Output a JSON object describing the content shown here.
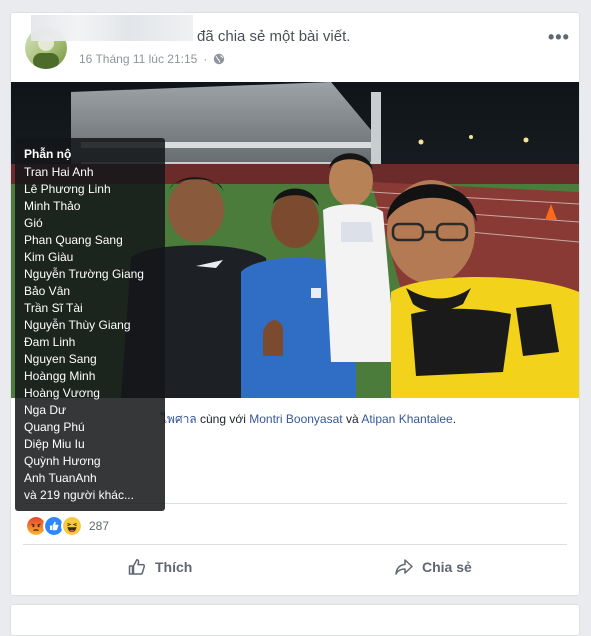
{
  "post": {
    "shared_text": "đã chia sẻ một bài viết.",
    "timestamp": "16 Tháng 11 lúc 21:15",
    "privacy_icon": "globe-icon",
    "more_icon": "more-options-icon",
    "tag_prefix": "ไพศาล",
    "tag_with": "cùng với",
    "tag_person1": "Montri Boonyasat",
    "tag_and": "và",
    "tag_person2": "Atipan Khantalee",
    "tag_end": "."
  },
  "reactions": {
    "icons": [
      "angry-reaction-icon",
      "like-reaction-icon",
      "haha-reaction-icon"
    ],
    "count": "287"
  },
  "actions": {
    "like_label": "Thích",
    "share_label": "Chia sẻ"
  },
  "tooltip": {
    "title": "Phẫn nộ",
    "names": [
      "Tran Hai Anh",
      "Lê Phương Linh",
      "Minh Thảo",
      "Gió",
      "Phan Quang Sang",
      "Kim Giàu",
      "Nguyễn Trường Giang",
      "Bảo Vân",
      "Trần Sĩ Tài",
      "Nguyễn Thùy Giang",
      "Đam Linh",
      "Nguyen Sang",
      "Hoàngg Minh",
      "Hoàng Vương",
      "Nga Dư",
      "Quang Phú",
      "Diệp Miu Iu",
      "Quỳnh Hương",
      "Anh TuanAnh",
      "và 219 người khác..."
    ]
  },
  "colors": {
    "link": "#365899",
    "tooltip_bg": "#141619",
    "angry": "#f0622c",
    "like": "#2d88ff",
    "haha": "#f7c940"
  }
}
